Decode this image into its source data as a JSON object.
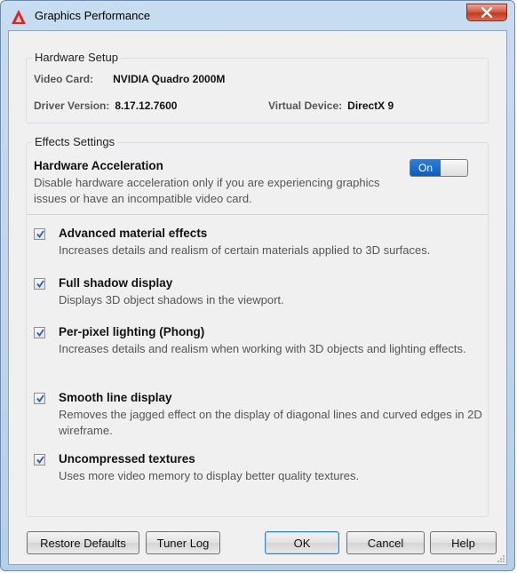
{
  "window": {
    "title": "Graphics Performance"
  },
  "hardware_setup": {
    "legend": "Hardware Setup",
    "video_card_label": "Video Card:",
    "video_card_value": "NVIDIA Quadro 2000M",
    "driver_version_label": "Driver Version:",
    "driver_version_value": "8.17.12.7600",
    "virtual_device_label": "Virtual Device:",
    "virtual_device_value": "DirectX 9"
  },
  "effects_settings": {
    "legend": "Effects Settings",
    "hardware_acceleration": {
      "title": "Hardware Acceleration",
      "description": "Disable hardware acceleration only if you are experiencing graphics issues or have an incompatible video card.",
      "toggle_label": "On",
      "enabled": true
    },
    "options": [
      {
        "title": "Advanced material effects",
        "description": "Increases details and realism of certain materials applied to 3D surfaces.",
        "checked": true
      },
      {
        "title": "Full shadow display",
        "description": "Displays 3D object shadows in the viewport.",
        "checked": true
      },
      {
        "title": "Per-pixel lighting (Phong)",
        "description": "Increases details and realism when working with 3D objects and lighting effects.",
        "checked": true
      },
      {
        "title": "Smooth line display",
        "description": "Removes the jagged effect on the display of diagonal lines and curved edges in 2D wireframe.",
        "checked": true
      },
      {
        "title": "Uncompressed textures",
        "description": "Uses more video memory to display better quality textures.",
        "checked": true
      }
    ]
  },
  "buttons": {
    "restore_defaults": "Restore Defaults",
    "tuner_log": "Tuner Log",
    "ok": "OK",
    "cancel": "Cancel",
    "help": "Help"
  },
  "colors": {
    "accent": "#0b5bc0",
    "close": "#c23a22",
    "app_icon": "#d8262b"
  }
}
